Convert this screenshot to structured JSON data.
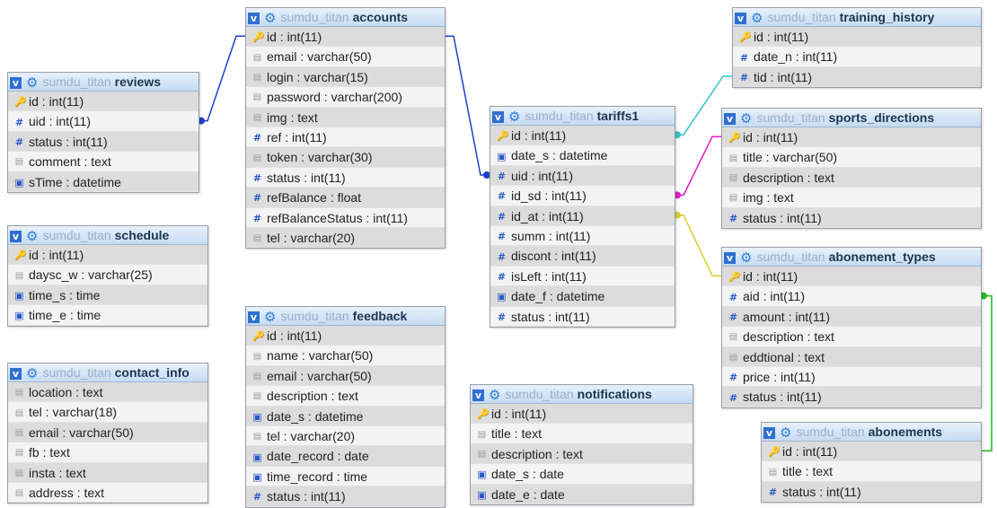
{
  "database": "sumdu_titan",
  "colors": {
    "blue": "#1f3ec8",
    "cyan": "#2ec6c6",
    "magenta": "#e01cc4",
    "yellow": "#d8d02a",
    "green": "#22b822"
  },
  "tables": [
    {
      "name": "reviews",
      "columns": [
        {
          "label": "id : int(11)",
          "icon": "key-icon"
        },
        {
          "label": "uid : int(11)",
          "icon": "number-icon"
        },
        {
          "label": "status : int(11)",
          "icon": "number-icon"
        },
        {
          "label": "comment : text",
          "icon": "text-icon"
        },
        {
          "label": "sTime : datetime",
          "icon": "date-icon"
        }
      ]
    },
    {
      "name": "accounts",
      "columns": [
        {
          "label": "id : int(11)",
          "icon": "key-icon"
        },
        {
          "label": "email : varchar(50)",
          "icon": "text-icon"
        },
        {
          "label": "login : varchar(15)",
          "icon": "text-icon"
        },
        {
          "label": "password : varchar(200)",
          "icon": "text-icon"
        },
        {
          "label": "img : text",
          "icon": "text-icon"
        },
        {
          "label": "ref : int(11)",
          "icon": "number-icon"
        },
        {
          "label": "token : varchar(30)",
          "icon": "text-icon"
        },
        {
          "label": "status : int(11)",
          "icon": "number-icon"
        },
        {
          "label": "refBalance : float",
          "icon": "number-icon"
        },
        {
          "label": "refBalanceStatus : int(11)",
          "icon": "number-icon"
        },
        {
          "label": "tel : varchar(20)",
          "icon": "text-icon"
        }
      ]
    },
    {
      "name": "schedule",
      "columns": [
        {
          "label": "id : int(11)",
          "icon": "key-icon"
        },
        {
          "label": "daysc_w : varchar(25)",
          "icon": "text-icon"
        },
        {
          "label": "time_s : time",
          "icon": "date-icon"
        },
        {
          "label": "time_e : time",
          "icon": "date-icon"
        }
      ]
    },
    {
      "name": "contact_info",
      "columns": [
        {
          "label": "location : text",
          "icon": "text-icon"
        },
        {
          "label": "tel : varchar(18)",
          "icon": "text-icon"
        },
        {
          "label": "email : varchar(50)",
          "icon": "text-icon"
        },
        {
          "label": "fb : text",
          "icon": "text-icon"
        },
        {
          "label": "insta : text",
          "icon": "text-icon"
        },
        {
          "label": "address : text",
          "icon": "text-icon"
        }
      ]
    },
    {
      "name": "feedback",
      "columns": [
        {
          "label": "id : int(11)",
          "icon": "key-icon"
        },
        {
          "label": "name : varchar(50)",
          "icon": "text-icon"
        },
        {
          "label": "email : varchar(50)",
          "icon": "text-icon"
        },
        {
          "label": "description : text",
          "icon": "text-icon"
        },
        {
          "label": "date_s : datetime",
          "icon": "date-icon"
        },
        {
          "label": "tel : varchar(20)",
          "icon": "text-icon"
        },
        {
          "label": "date_record : date",
          "icon": "date-icon"
        },
        {
          "label": "time_record : time",
          "icon": "date-icon"
        },
        {
          "label": "status : int(11)",
          "icon": "number-icon"
        }
      ]
    },
    {
      "name": "tariffs1",
      "columns": [
        {
          "label": "id : int(11)",
          "icon": "key-icon"
        },
        {
          "label": "date_s : datetime",
          "icon": "date-icon"
        },
        {
          "label": "uid : int(11)",
          "icon": "number-icon"
        },
        {
          "label": "id_sd : int(11)",
          "icon": "number-icon"
        },
        {
          "label": "id_at : int(11)",
          "icon": "number-icon"
        },
        {
          "label": "summ : int(11)",
          "icon": "number-icon"
        },
        {
          "label": "discont : int(11)",
          "icon": "number-icon"
        },
        {
          "label": "isLeft : int(11)",
          "icon": "number-icon"
        },
        {
          "label": "date_f : datetime",
          "icon": "date-icon"
        },
        {
          "label": "status : int(11)",
          "icon": "number-icon"
        }
      ]
    },
    {
      "name": "notifications",
      "columns": [
        {
          "label": "id : int(11)",
          "icon": "key-icon"
        },
        {
          "label": "title : text",
          "icon": "text-icon"
        },
        {
          "label": "description : text",
          "icon": "text-icon"
        },
        {
          "label": "date_s : date",
          "icon": "date-icon"
        },
        {
          "label": "date_e : date",
          "icon": "date-icon"
        }
      ]
    },
    {
      "name": "training_history",
      "columns": [
        {
          "label": "id : int(11)",
          "icon": "key-icon"
        },
        {
          "label": "date_n : int(11)",
          "icon": "number-icon"
        },
        {
          "label": "tid : int(11)",
          "icon": "number-icon"
        }
      ]
    },
    {
      "name": "sports_directions",
      "columns": [
        {
          "label": "id : int(11)",
          "icon": "key-icon"
        },
        {
          "label": "title : varchar(50)",
          "icon": "text-icon"
        },
        {
          "label": "description : text",
          "icon": "text-icon"
        },
        {
          "label": "img : text",
          "icon": "text-icon"
        },
        {
          "label": "status : int(11)",
          "icon": "number-icon"
        }
      ]
    },
    {
      "name": "abonement_types",
      "columns": [
        {
          "label": "id : int(11)",
          "icon": "key-icon"
        },
        {
          "label": "aid : int(11)",
          "icon": "number-icon"
        },
        {
          "label": "amount : int(11)",
          "icon": "number-icon"
        },
        {
          "label": "description : text",
          "icon": "text-icon"
        },
        {
          "label": "eddtional : text",
          "icon": "text-icon"
        },
        {
          "label": "price : int(11)",
          "icon": "number-icon"
        },
        {
          "label": "status : int(11)",
          "icon": "number-icon"
        }
      ]
    },
    {
      "name": "abonements",
      "columns": [
        {
          "label": "id : int(11)",
          "icon": "key-icon"
        },
        {
          "label": "title : text",
          "icon": "text-icon"
        },
        {
          "label": "status : int(11)",
          "icon": "number-icon"
        }
      ]
    }
  ],
  "relations": [
    {
      "from": "reviews.uid",
      "to": "accounts.id",
      "color": "blue"
    },
    {
      "from": "tariffs1.uid",
      "to": "accounts.id",
      "color": "blue"
    },
    {
      "from": "tariffs1.id",
      "to": "training_history.tid",
      "color": "cyan"
    },
    {
      "from": "tariffs1.id_sd",
      "to": "sports_directions.id",
      "color": "magenta"
    },
    {
      "from": "tariffs1.id_at",
      "to": "abonement_types.id",
      "color": "yellow"
    },
    {
      "from": "abonement_types.aid",
      "to": "abonements.id",
      "color": "green"
    }
  ]
}
